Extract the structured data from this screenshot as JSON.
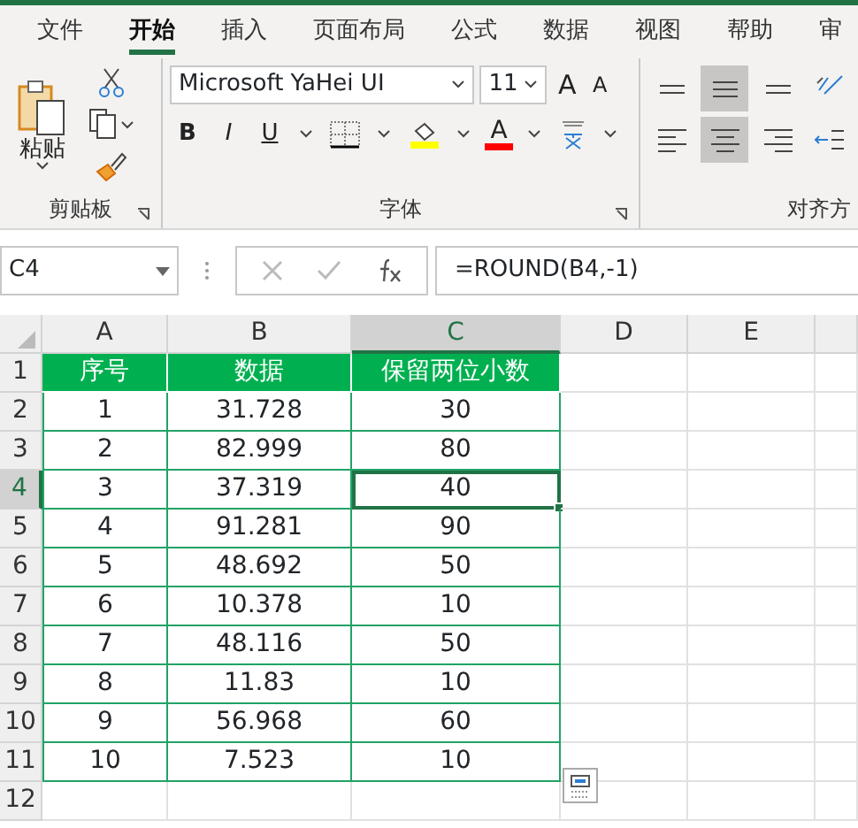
{
  "tabs": [
    {
      "label": "文件",
      "selected": false
    },
    {
      "label": "开始",
      "selected": true
    },
    {
      "label": "插入",
      "selected": false
    },
    {
      "label": "页面布局",
      "selected": false
    },
    {
      "label": "公式",
      "selected": false
    },
    {
      "label": "数据",
      "selected": false
    },
    {
      "label": "视图",
      "selected": false
    },
    {
      "label": "帮助",
      "selected": false
    },
    {
      "label": "审",
      "selected": false
    }
  ],
  "clipboard": {
    "paste_label": "粘贴",
    "group_label": "剪贴板"
  },
  "font": {
    "font_name": "Microsoft YaHei UI",
    "font_size": "11",
    "grow": "A",
    "shrink": "A",
    "styles": [
      "B",
      "I",
      "U"
    ],
    "font_color_letter": "A",
    "group_label": "字体"
  },
  "alignment": {
    "group_label": "对齐方",
    "buttons": [
      {
        "kind": "top",
        "selected": false
      },
      {
        "kind": "middle",
        "selected": true
      },
      {
        "kind": "bottom",
        "selected": false
      },
      {
        "kind": "left",
        "selected": false
      },
      {
        "kind": "center",
        "selected": true
      },
      {
        "kind": "right",
        "selected": false
      }
    ]
  },
  "name_box": "C4",
  "formula": "=ROUND(B4,-1)",
  "columns": [
    {
      "label": "A",
      "selected": false
    },
    {
      "label": "B",
      "selected": false
    },
    {
      "label": "C",
      "selected": true
    },
    {
      "label": "D",
      "selected": false
    },
    {
      "label": "E",
      "selected": false
    }
  ],
  "rows": [
    {
      "header": "1",
      "selected": false,
      "kind": "header",
      "cells": [
        "序号",
        "数据",
        "保留两位小数"
      ]
    },
    {
      "header": "2",
      "selected": false,
      "kind": "data",
      "cells": [
        "1",
        "31.728",
        "30"
      ]
    },
    {
      "header": "3",
      "selected": false,
      "kind": "data",
      "cells": [
        "2",
        "82.999",
        "80"
      ]
    },
    {
      "header": "4",
      "selected": true,
      "kind": "data",
      "cells": [
        "3",
        "37.319",
        "40"
      ]
    },
    {
      "header": "5",
      "selected": false,
      "kind": "data",
      "cells": [
        "4",
        "91.281",
        "90"
      ]
    },
    {
      "header": "6",
      "selected": false,
      "kind": "data",
      "cells": [
        "5",
        "48.692",
        "50"
      ]
    },
    {
      "header": "7",
      "selected": false,
      "kind": "data",
      "cells": [
        "6",
        "10.378",
        "10"
      ]
    },
    {
      "header": "8",
      "selected": false,
      "kind": "data",
      "cells": [
        "7",
        "48.116",
        "50"
      ]
    },
    {
      "header": "9",
      "selected": false,
      "kind": "data",
      "cells": [
        "8",
        "11.83",
        "10"
      ]
    },
    {
      "header": "10",
      "selected": false,
      "kind": "data",
      "cells": [
        "9",
        "56.968",
        "60"
      ]
    },
    {
      "header": "11",
      "selected": false,
      "kind": "data",
      "cells": [
        "10",
        "7.523",
        "10"
      ]
    },
    {
      "header": "12",
      "selected": false
    }
  ]
}
